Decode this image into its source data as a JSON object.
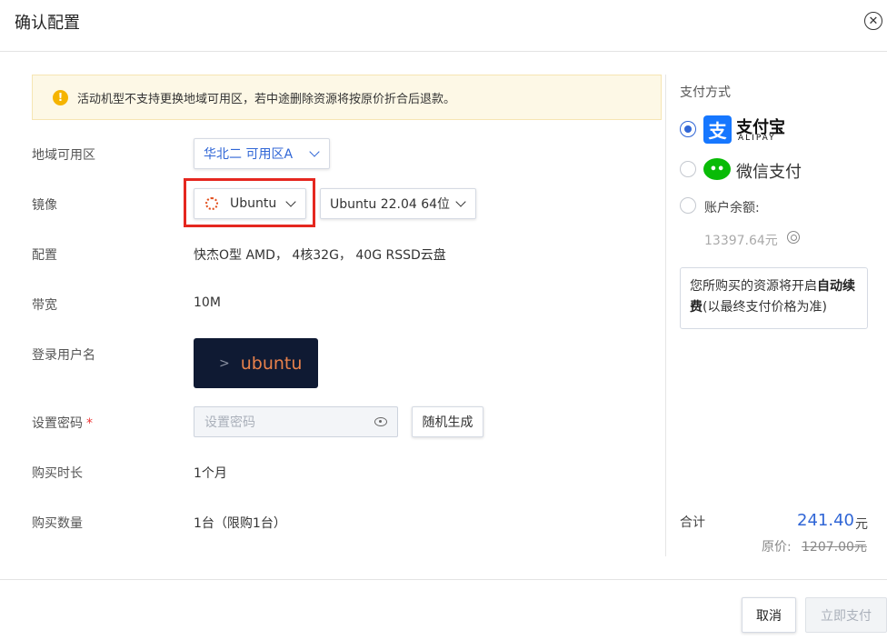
{
  "dialog": {
    "title": "确认配置",
    "close_glyph": "✕"
  },
  "notice": {
    "icon_glyph": "!",
    "text": "活动机型不支持更换地域可用区，若中途删除资源将按原价折合后退款。"
  },
  "form": {
    "region": {
      "label": "地域可用区",
      "value": "华北二 可用区A"
    },
    "image": {
      "label": "镜像",
      "os": "Ubuntu",
      "version": "Ubuntu 22.04 64位"
    },
    "config": {
      "label": "配置",
      "value": "快杰O型 AMD， 4核32G， 40G RSSD云盘"
    },
    "bandwidth": {
      "label": "带宽",
      "value": "10M"
    },
    "login_user": {
      "label": "登录用户名",
      "prompt": ">",
      "value": "ubuntu"
    },
    "password": {
      "label": "设置密码",
      "required_mark": "*",
      "placeholder": "设置密码",
      "generate_label": "随机生成"
    },
    "duration": {
      "label": "购买时长",
      "value": "1个月"
    },
    "quantity": {
      "label": "购买数量",
      "value": "1台（限购1台）"
    }
  },
  "payment": {
    "title": "支付方式",
    "alipay": {
      "name": "支付宝",
      "sub": "ALIPAY",
      "logo_glyph": "支",
      "selected": true
    },
    "wechat": {
      "name": "微信支付",
      "logo_glyph": "••",
      "selected": false
    },
    "balance": {
      "label": "账户余额:",
      "value": "13397.64元",
      "selected": false
    },
    "renew_notice": {
      "prefix": "您所购买的资源将开启",
      "bold": "自动续费",
      "suffix": "(以最终支付价格为准)"
    }
  },
  "summary": {
    "total_label": "合计",
    "total_value": "241.40",
    "total_unit": "元",
    "original_label": "原价:",
    "original_value": "1207.00元"
  },
  "footer": {
    "cancel_label": "取消",
    "pay_label": "立即支付"
  },
  "colors": {
    "accent": "#3066d6",
    "highlight_border": "#e5271f",
    "alipay": "#1677ff",
    "wechat": "#09bb07",
    "ubuntu_tile_bg": "#0f1a33",
    "ubuntu_text": "#e8814b"
  },
  "icons": {
    "close": "close-icon",
    "warning": "warning-icon",
    "chevron": "chevron-down-icon",
    "ubuntu": "ubuntu-icon",
    "eye": "eye-icon",
    "refresh": "refresh-icon",
    "alipay": "alipay-icon",
    "wechat": "wechat-icon"
  }
}
